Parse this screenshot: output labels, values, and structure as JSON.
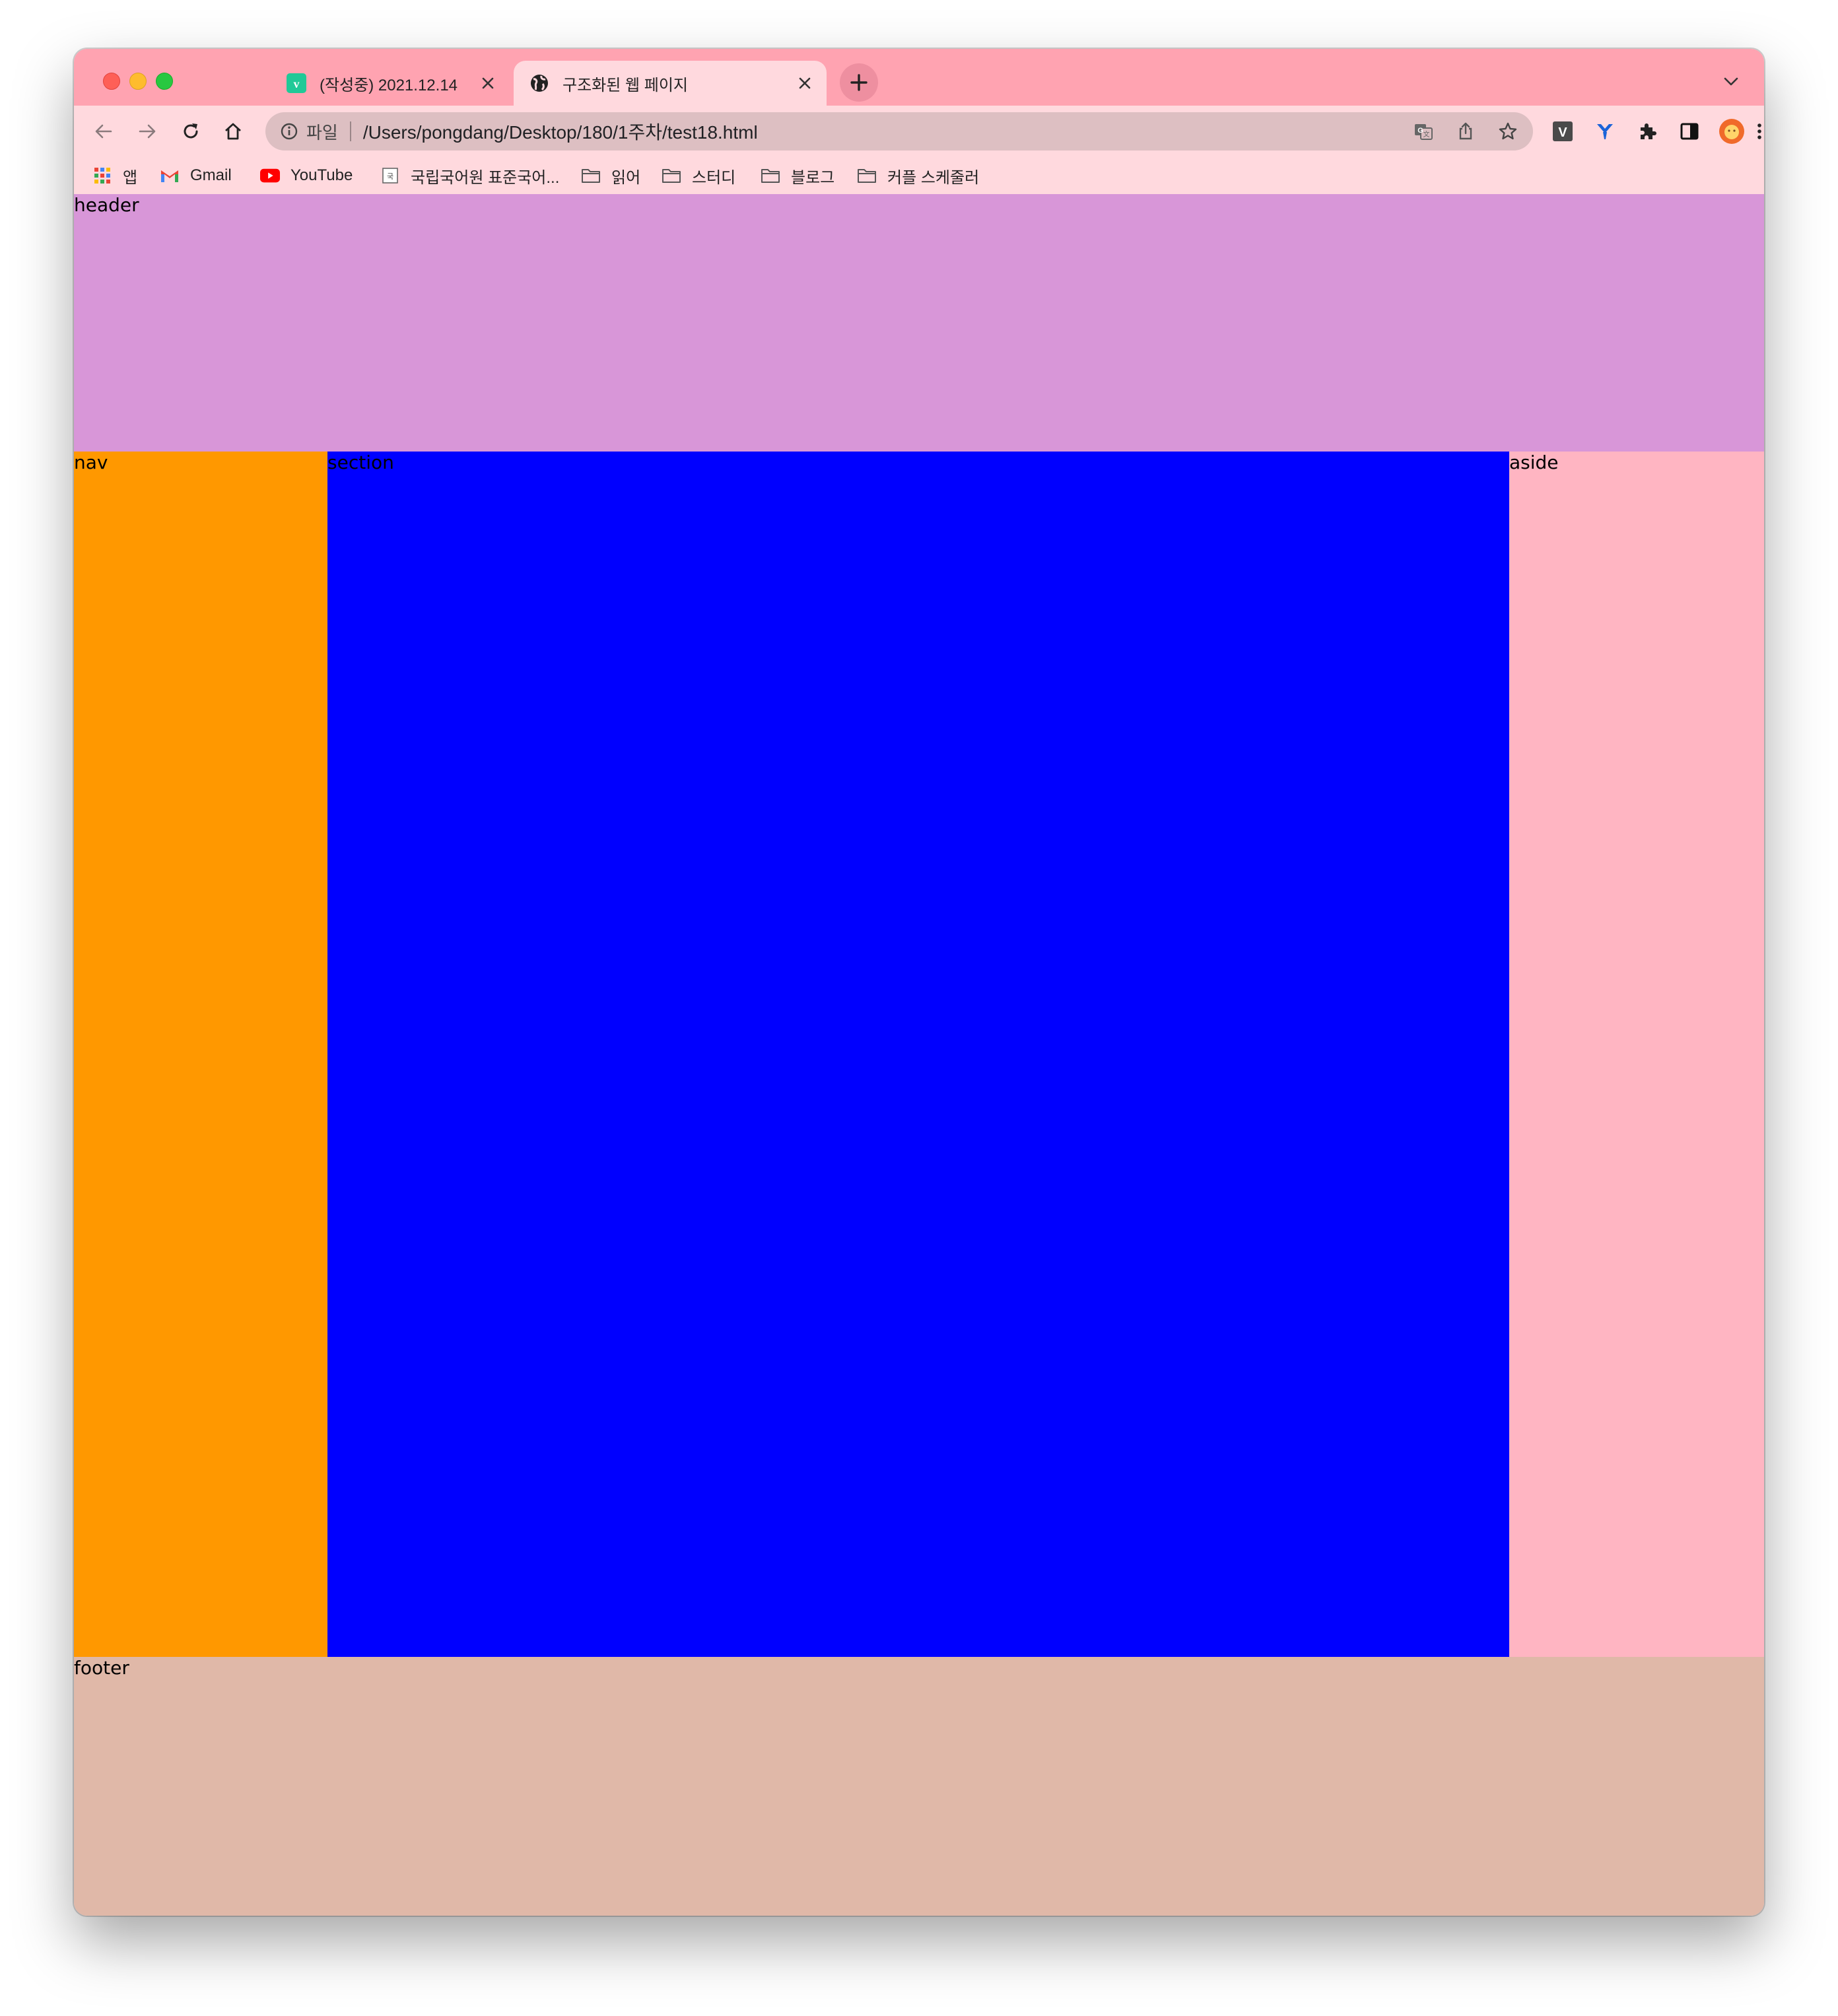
{
  "browser": {
    "tabs": [
      {
        "title": "(작성중) 2021.12.14",
        "favicon": "velog-icon",
        "active": false
      },
      {
        "title": "구조화된 웹 페이지",
        "favicon": "globe-icon",
        "active": true
      }
    ],
    "address": {
      "scheme_label": "파일",
      "url": "/Users/pongdang/Desktop/180/1주차/test18.html"
    },
    "bookmarks": [
      {
        "label": "앱",
        "icon": "apps-grid-icon"
      },
      {
        "label": "Gmail",
        "icon": "gmail-icon"
      },
      {
        "label": "YouTube",
        "icon": "youtube-icon"
      },
      {
        "label": "국립국어원 표준국어...",
        "icon": "dictionary-icon"
      },
      {
        "label": "읽어",
        "icon": "folder-icon"
      },
      {
        "label": "스터디",
        "icon": "folder-icon"
      },
      {
        "label": "블로그",
        "icon": "folder-icon"
      },
      {
        "label": "커플 스케줄러",
        "icon": "folder-icon"
      }
    ],
    "colors": {
      "tabstrip": "#ffa3b1",
      "toolbar": "#ffd9de",
      "omnibox": "#ddbfc2"
    }
  },
  "page": {
    "header": {
      "label": "header",
      "color": "#d896d8"
    },
    "nav": {
      "label": "nav",
      "color": "#ff9800"
    },
    "section": {
      "label": "section",
      "color": "#0000ff"
    },
    "aside": {
      "label": "aside",
      "color": "#ffb5c2"
    },
    "footer": {
      "label": "footer",
      "color": "#e0b8a8"
    }
  }
}
